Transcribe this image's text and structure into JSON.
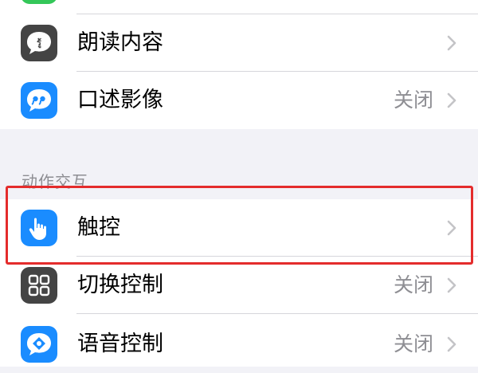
{
  "accessibility": {
    "top_group": [
      {
        "label": "",
        "value": "",
        "icon": "green-app-icon",
        "icon_color": "#34c759"
      },
      {
        "label": "朗读内容",
        "value": "",
        "icon": "speech-bubble-icon",
        "icon_color": "#444444"
      },
      {
        "label": "口述影像",
        "value": "关闭",
        "icon": "quote-bubble-icon",
        "icon_color": "#1a8cff"
      }
    ],
    "section_header": "动作交互",
    "motion_group": [
      {
        "label": "触控",
        "value": "",
        "icon": "hand-pointer-icon",
        "icon_color": "#1a8cff"
      },
      {
        "label": "切换控制",
        "value": "关闭",
        "icon": "grid-icon",
        "icon_color": "#444444"
      },
      {
        "label": "语音控制",
        "value": "关闭",
        "icon": "voice-control-icon",
        "icon_color": "#1a8cff"
      }
    ]
  },
  "highlight_color": "#e42c2c"
}
